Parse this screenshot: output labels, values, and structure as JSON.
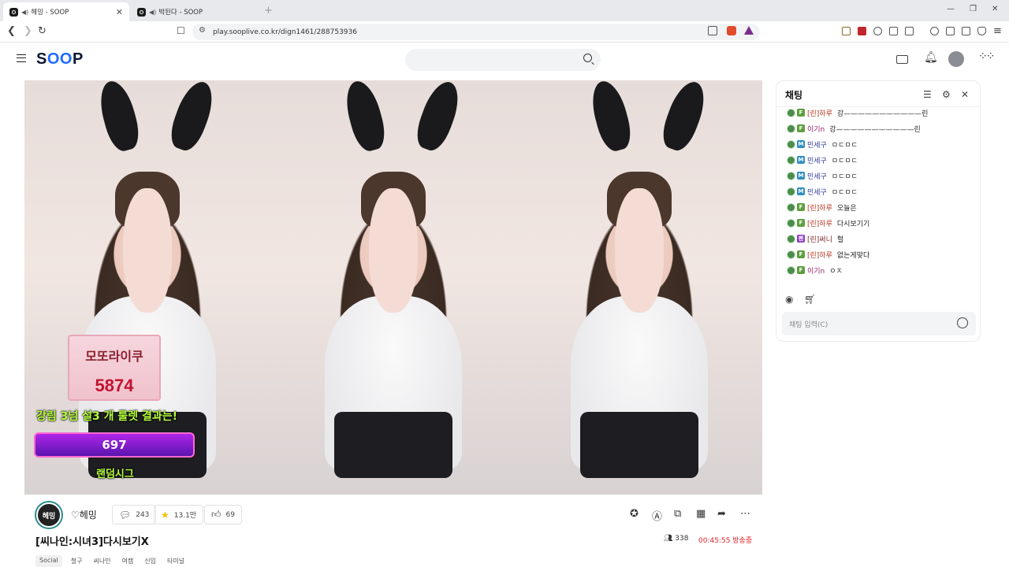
{
  "browser": {
    "tabs": [
      {
        "title": "헤밍 - SOOP",
        "active": true
      },
      {
        "title": "박된다 - SOOP",
        "active": false
      }
    ],
    "url": "play.sooplive.co.kr/dign1461/288753936"
  },
  "site": {
    "logo": {
      "s": "S",
      "oo": "OO",
      "p": "P"
    },
    "search_placeholder": ""
  },
  "video_overlay": {
    "card_number": "5874",
    "card_text": "모또라이쿠",
    "roulette_text": "강림  3넘  설3  개 룰렛 결과는!",
    "bar_value": "697",
    "random_text": "랜덤시그"
  },
  "stream": {
    "avatar_label": "헤밍",
    "streamer_name": "♡헤밍",
    "chat_count": "243",
    "favorites": "13.1만",
    "likes": "69",
    "title": "[씨나인:시녀3]다시보기X",
    "viewers": "338",
    "uptime": "00:45:55 방송중",
    "tags": [
      "Social",
      "철구",
      "씨나인",
      "여캠",
      "신입",
      "타미널"
    ]
  },
  "chat": {
    "title": "채팅",
    "input_placeholder": "채팅 입력(C)",
    "messages": [
      {
        "badge": "F",
        "badge_color": "#5c9e3c",
        "nick": "[린]하루",
        "nick_color": "#b5361d",
        "text": "강———————————린"
      },
      {
        "badge": "F",
        "badge_color": "#5c9e3c",
        "nick": "이기n",
        "nick_color": "#9a1a6b",
        "text": "강———————————린"
      },
      {
        "badge": "M",
        "badge_color": "#2f8fbf",
        "nick": "민세구",
        "nick_color": "#2b3a9a",
        "text": "ㅁㄷㅁㄷ"
      },
      {
        "badge": "M",
        "badge_color": "#2f8fbf",
        "nick": "민세구",
        "nick_color": "#2b3a9a",
        "text": "ㅁㄷㅁㄷ"
      },
      {
        "badge": "M",
        "badge_color": "#2f8fbf",
        "nick": "민세구",
        "nick_color": "#2b3a9a",
        "text": "ㅁㄷㅁㄷ"
      },
      {
        "badge": "M",
        "badge_color": "#2f8fbf",
        "nick": "민세구",
        "nick_color": "#2b3a9a",
        "text": "ㅁㄷㅁㄷ"
      },
      {
        "badge": "F",
        "badge_color": "#5c9e3c",
        "nick": "[린]하루",
        "nick_color": "#b5361d",
        "text": "오늘은"
      },
      {
        "badge": "F",
        "badge_color": "#5c9e3c",
        "nick": "[린]하루",
        "nick_color": "#b5361d",
        "text": "다시보기기"
      },
      {
        "badge": "팬",
        "badge_color": "#8a3ec4",
        "nick": "[린]써니",
        "nick_color": "#7a2a2a",
        "text": "헐"
      },
      {
        "badge": "F",
        "badge_color": "#5c9e3c",
        "nick": "[린]하루",
        "nick_color": "#b5361d",
        "text": "없는게맞다"
      },
      {
        "badge": "F",
        "badge_color": "#5c9e3c",
        "nick": "이기n",
        "nick_color": "#9a1a6b",
        "text": "ㅇㅈ"
      }
    ]
  }
}
